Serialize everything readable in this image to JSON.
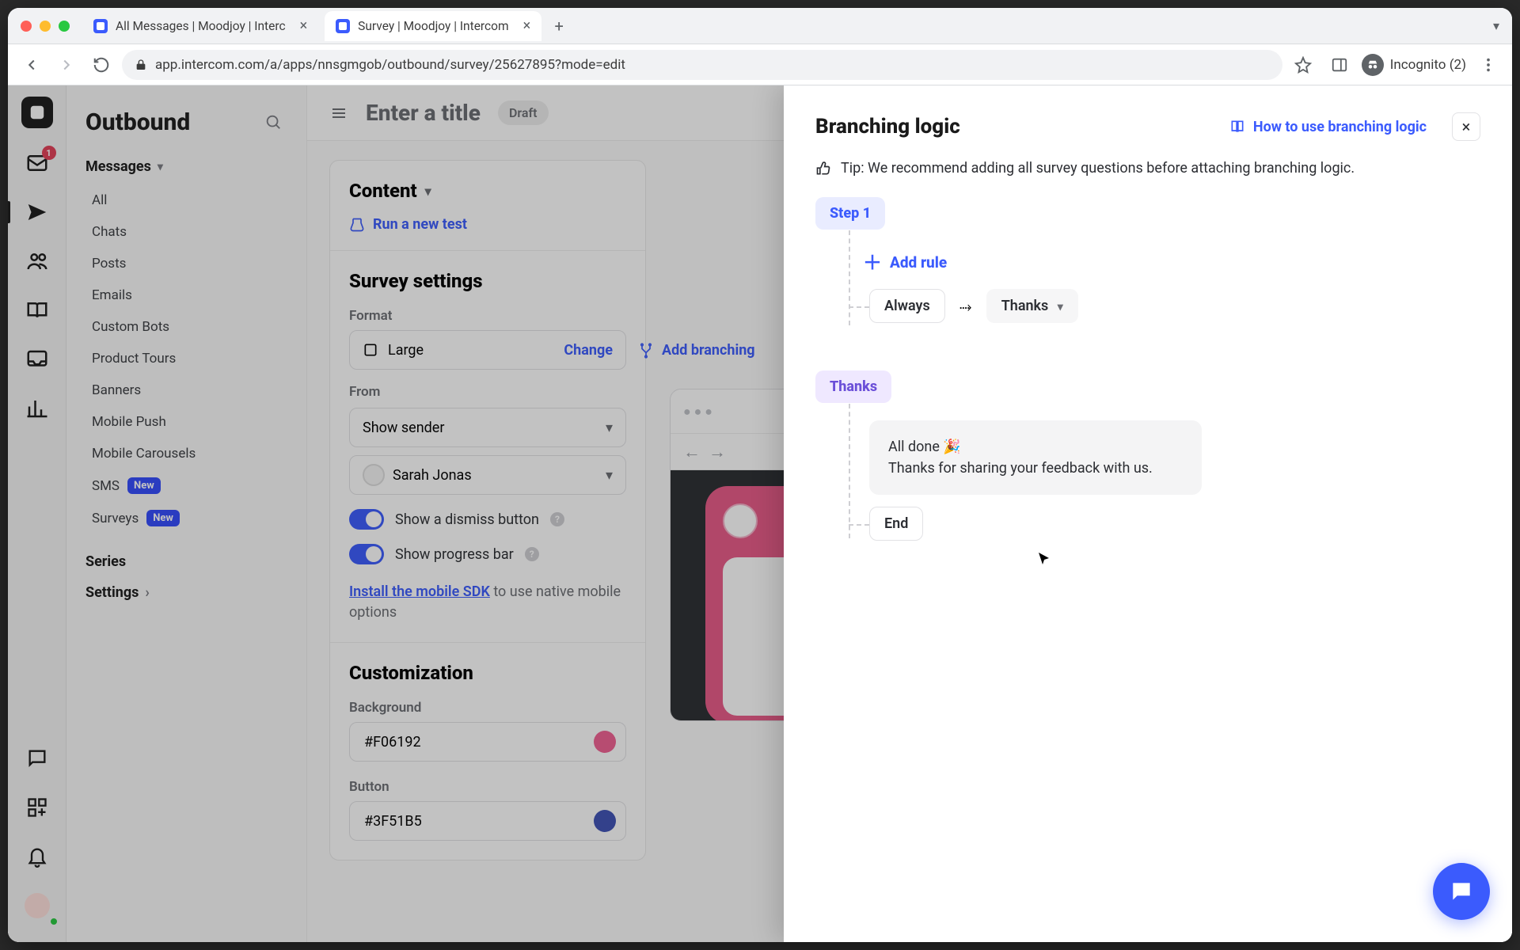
{
  "browser": {
    "tabs": [
      {
        "title": "All Messages | Moodjoy | Interc",
        "active": false
      },
      {
        "title": "Survey | Moodjoy | Intercom",
        "active": true
      }
    ],
    "url": "app.intercom.com/a/apps/nnsgmgob/outbound/survey/25627895?mode=edit",
    "incognito_label": "Incognito (2)"
  },
  "rail": {
    "inbox_badge": "1"
  },
  "sidebar": {
    "title": "Outbound",
    "group_label": "Messages",
    "items": [
      {
        "label": "All"
      },
      {
        "label": "Chats"
      },
      {
        "label": "Posts"
      },
      {
        "label": "Emails"
      },
      {
        "label": "Custom Bots"
      },
      {
        "label": "Product Tours"
      },
      {
        "label": "Banners"
      },
      {
        "label": "Mobile Push"
      },
      {
        "label": "Mobile Carousels"
      },
      {
        "label": "SMS",
        "new": "New"
      },
      {
        "label": "Surveys",
        "new": "New"
      }
    ],
    "series_label": "Series",
    "settings_label": "Settings"
  },
  "page": {
    "title_placeholder": "Enter a title",
    "draft": "Draft",
    "content_header": "Content",
    "run_test": "Run a new test",
    "add_branching": "Add branching"
  },
  "survey_settings": {
    "title": "Survey settings",
    "format_label": "Format",
    "format_value": "Large",
    "change": "Change",
    "from_label": "From",
    "from_select": "Show sender",
    "from_person": "Sarah Jonas",
    "toggle_dismiss": "Show a dismiss button",
    "toggle_progress": "Show progress bar",
    "sdk_link": "Install the mobile SDK",
    "sdk_rest": " to use native mobile options"
  },
  "customization": {
    "title": "Customization",
    "background_label": "Background",
    "background_value": "#F06192",
    "button_label": "Button",
    "button_value": "#3F51B5"
  },
  "panel": {
    "title": "Branching logic",
    "howto": "How to use branching logic",
    "tip": "Tip: We recommend adding all survey questions before attaching branching logic.",
    "step1": "Step 1",
    "add_rule": "Add rule",
    "always": "Always",
    "thanks_target": "Thanks",
    "thanks_label": "Thanks",
    "thanks_line1": "All done 🎉",
    "thanks_line2": "Thanks for sharing your feedback with us.",
    "end": "End"
  }
}
